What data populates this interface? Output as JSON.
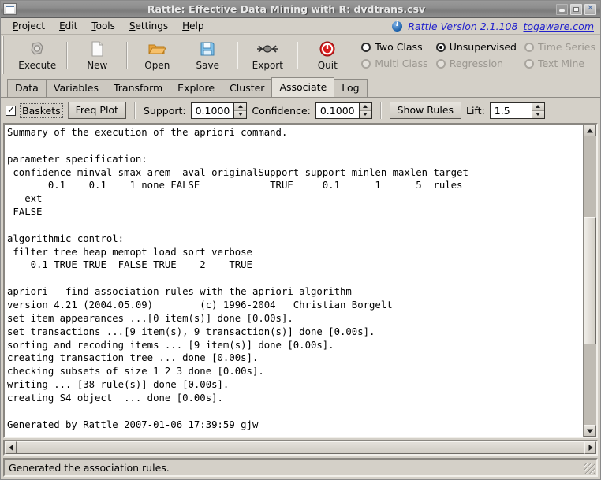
{
  "window": {
    "title": "Rattle: Effective Data Mining with R: dvdtrans.csv",
    "menu_icon": "window-menu-icon",
    "buttons": [
      {
        "name": "minimize",
        "glyph": "minimize-icon"
      },
      {
        "name": "maximize",
        "glyph": "maximize-icon"
      },
      {
        "name": "close",
        "glyph": "close-icon"
      }
    ]
  },
  "menubar": {
    "items": [
      {
        "label": "Project",
        "mnemonic": "P"
      },
      {
        "label": "Edit",
        "mnemonic": "E"
      },
      {
        "label": "Tools",
        "mnemonic": "T"
      },
      {
        "label": "Settings",
        "mnemonic": "S"
      },
      {
        "label": "Help",
        "mnemonic": "H"
      }
    ],
    "info_icon": "info-icon",
    "version_text": "Rattle  Version  2.1.108",
    "version_link": "togaware.com",
    "link_color": "#2222cc"
  },
  "toolbar": {
    "buttons": [
      {
        "label": "Execute",
        "icon": "gear-icon"
      },
      {
        "label": "New",
        "icon": "new-document-icon"
      },
      {
        "label": "Open",
        "icon": "open-folder-icon"
      },
      {
        "label": "Save",
        "icon": "save-disk-icon"
      },
      {
        "label": "Export",
        "icon": "export-icon"
      },
      {
        "label": "Quit",
        "icon": "power-quit-icon"
      }
    ]
  },
  "mode_radios": {
    "row1": [
      {
        "label": "Two Class",
        "selected": false,
        "disabled": false
      },
      {
        "label": "Unsupervised",
        "selected": true,
        "disabled": false
      },
      {
        "label": "Time Series",
        "selected": false,
        "disabled": true
      }
    ],
    "row2": [
      {
        "label": "Multi Class",
        "selected": false,
        "disabled": true
      },
      {
        "label": "Regression",
        "selected": false,
        "disabled": true
      },
      {
        "label": "Text Mine",
        "selected": false,
        "disabled": true
      }
    ]
  },
  "tabs": [
    {
      "label": "Data",
      "active": false
    },
    {
      "label": "Variables",
      "active": false
    },
    {
      "label": "Transform",
      "active": false
    },
    {
      "label": "Explore",
      "active": false
    },
    {
      "label": "Cluster",
      "active": false
    },
    {
      "label": "Associate",
      "active": true
    },
    {
      "label": "Log",
      "active": false
    }
  ],
  "options": {
    "baskets_label": "Baskets",
    "baskets_checked": true,
    "freq_plot_label": "Freq Plot",
    "support_label": "Support:",
    "support_value": "0.1000",
    "confidence_label": "Confidence:",
    "confidence_value": "0.1000",
    "show_rules_label": "Show Rules",
    "lift_label": "Lift:",
    "lift_value": "1.5"
  },
  "text_output": "Summary of the execution of the apriori command.\n\nparameter specification:\n confidence minval smax arem  aval originalSupport support minlen maxlen target\n       0.1    0.1    1 none FALSE            TRUE     0.1      1      5  rules\n   ext\n FALSE\n\nalgorithmic control:\n filter tree heap memopt load sort verbose\n    0.1 TRUE TRUE  FALSE TRUE    2    TRUE\n\napriori - find association rules with the apriori algorithm\nversion 4.21 (2004.05.09)        (c) 1996-2004   Christian Borgelt\nset item appearances ...[0 item(s)] done [0.00s].\nset transactions ...[9 item(s), 9 transaction(s)] done [0.00s].\nsorting and recoding items ... [9 item(s)] done [0.00s].\ncreating transaction tree ... done [0.00s].\nchecking subsets of size 1 2 3 done [0.00s].\nwriting ... [38 rule(s)] done [0.00s].\ncreating S4 object  ... done [0.00s].\n\nGenerated by Rattle 2007-01-06 17:39:59 gjw",
  "scrollbars": {
    "vertical": {
      "thumb_top_pct": 28,
      "thumb_height_pct": 44
    },
    "horizontal": {
      "thumb_left_pct": 0,
      "thumb_width_pct": 100
    }
  },
  "statusbar": {
    "message": "Generated the association rules."
  }
}
